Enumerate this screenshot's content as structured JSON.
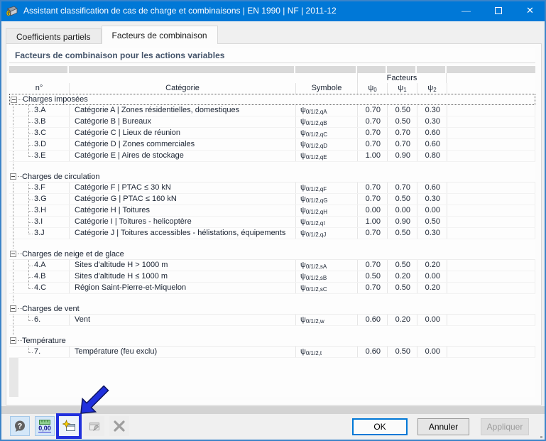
{
  "window": {
    "title": "Assistant classification de cas de charge et combinaisons | EN 1990 | NF | 2011-12",
    "titlebar_color": "#0078d7",
    "controls": {
      "minimize": "—",
      "maximize": "",
      "close": "✕"
    }
  },
  "tabs": [
    {
      "label": "Coefficients partiels",
      "active": false
    },
    {
      "label": "Facteurs de combinaison",
      "active": true
    }
  ],
  "section_label": "Facteurs de combinaison pour les actions variables",
  "table": {
    "headers": {
      "no": "n°",
      "category": "Catégorie",
      "symbol": "Symbole",
      "factors_group": "Facteurs",
      "psi": [
        {
          "base": "ψ",
          "sub": "0"
        },
        {
          "base": "ψ",
          "sub": "1"
        },
        {
          "base": "ψ",
          "sub": "2"
        }
      ]
    },
    "groups": [
      {
        "label": "Charges imposées",
        "selected": true,
        "rows": [
          {
            "no": "3.A",
            "category": "Catégorie A | Zones résidentielles, domestiques",
            "symbol_base": "ψ",
            "symbol_sub": "0/1/2,qA",
            "psi0": "0.70",
            "psi1": "0.50",
            "psi2": "0.30"
          },
          {
            "no": "3.B",
            "category": "Catégorie B | Bureaux",
            "symbol_base": "ψ",
            "symbol_sub": "0/1/2,qB",
            "psi0": "0.70",
            "psi1": "0.50",
            "psi2": "0.30"
          },
          {
            "no": "3.C",
            "category": "Catégorie C | Lieux de réunion",
            "symbol_base": "ψ",
            "symbol_sub": "0/1/2,qC",
            "psi0": "0.70",
            "psi1": "0.70",
            "psi2": "0.60"
          },
          {
            "no": "3.D",
            "category": "Catégorie D | Zones commerciales",
            "symbol_base": "ψ",
            "symbol_sub": "0/1/2,qD",
            "psi0": "0.70",
            "psi1": "0.70",
            "psi2": "0.60"
          },
          {
            "no": "3.E",
            "category": "Catégorie E | Aires de stockage",
            "symbol_base": "ψ",
            "symbol_sub": "0/1/2,qE",
            "psi0": "1.00",
            "psi1": "0.90",
            "psi2": "0.80"
          }
        ]
      },
      {
        "label": "Charges de circulation",
        "selected": false,
        "rows": [
          {
            "no": "3.F",
            "category": "Catégorie F | PTAC ≤ 30 kN",
            "symbol_base": "ψ",
            "symbol_sub": "0/1/2,qF",
            "psi0": "0.70",
            "psi1": "0.70",
            "psi2": "0.60"
          },
          {
            "no": "3.G",
            "category": "Catégorie G | PTAC ≤ 160 kN",
            "symbol_base": "ψ",
            "symbol_sub": "0/1/2,qG",
            "psi0": "0.70",
            "psi1": "0.50",
            "psi2": "0.30"
          },
          {
            "no": "3.H",
            "category": "Catégorie H | Toitures",
            "symbol_base": "ψ",
            "symbol_sub": "0/1/2,qH",
            "psi0": "0.00",
            "psi1": "0.00",
            "psi2": "0.00"
          },
          {
            "no": "3.I",
            "category": "Catégorie I | Toitures - helicoptère",
            "symbol_base": "ψ",
            "symbol_sub": "0/1/2,qI",
            "psi0": "1.00",
            "psi1": "0.90",
            "psi2": "0.50"
          },
          {
            "no": "3.J",
            "category": "Catégorie J | Toitures accessibles - hélistations, équipements",
            "symbol_base": "ψ",
            "symbol_sub": "0/1/2,qJ",
            "psi0": "0.70",
            "psi1": "0.50",
            "psi2": "0.30"
          }
        ]
      },
      {
        "label": "Charges de neige et de glace",
        "selected": false,
        "rows": [
          {
            "no": "4.A",
            "category": "Sites d'altitude H > 1000 m",
            "symbol_base": "ψ",
            "symbol_sub": "0/1/2,sA",
            "psi0": "0.70",
            "psi1": "0.50",
            "psi2": "0.20"
          },
          {
            "no": "4.B",
            "category": "Sites d'altitude H ≤ 1000 m",
            "symbol_base": "ψ",
            "symbol_sub": "0/1/2,sB",
            "psi0": "0.50",
            "psi1": "0.20",
            "psi2": "0.00"
          },
          {
            "no": "4.C",
            "category": "Région Saint-Pierre-et-Miquelon",
            "symbol_base": "ψ",
            "symbol_sub": "0/1/2,sC",
            "psi0": "0.70",
            "psi1": "0.50",
            "psi2": "0.20"
          }
        ]
      },
      {
        "label": "Charges de vent",
        "selected": false,
        "rows": [
          {
            "no": "6.",
            "category": "Vent",
            "symbol_base": "ψ",
            "symbol_sub": "0/1/2,w",
            "psi0": "0.60",
            "psi1": "0.20",
            "psi2": "0.00"
          }
        ]
      },
      {
        "label": "Température",
        "selected": false,
        "rows": [
          {
            "no": "7.",
            "category": "Température (feu exclu)",
            "symbol_base": "ψ",
            "symbol_sub": "0/1/2,t",
            "psi0": "0.60",
            "psi1": "0.50",
            "psi2": "0.00"
          }
        ]
      }
    ]
  },
  "toolbar": {
    "units_label": "0,00",
    "icons": [
      "help-icon",
      "units-icon",
      "new-combination-icon",
      "edit-combination-icon",
      "delete-icon"
    ]
  },
  "buttons": {
    "ok": "OK",
    "cancel": "Annuler",
    "apply": "Appliquer"
  },
  "annotation": {
    "type": "arrow-highlight",
    "color": "#2130dd",
    "target": "new-combination-button"
  }
}
